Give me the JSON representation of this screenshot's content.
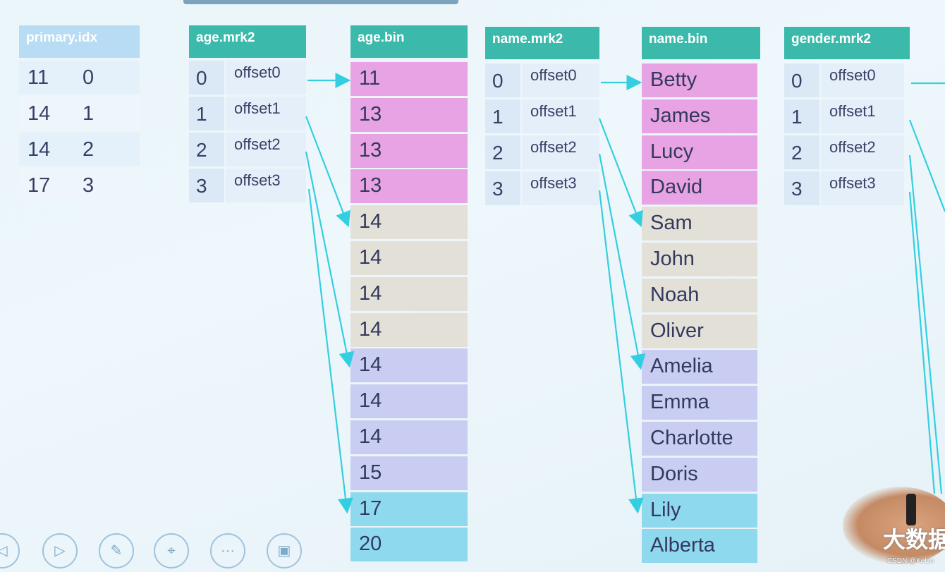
{
  "colors": {
    "teal_header": "#3bb9ab",
    "blue_header": "#b7dcf4",
    "pink": "#e7a3e3",
    "beige": "#e3e0d8",
    "lavender": "#c9cdf2",
    "cyan": "#8fd9ee",
    "arrow": "#33cfe0"
  },
  "primary_idx": {
    "title": "primary.idx",
    "rows": [
      [
        "11",
        "0"
      ],
      [
        "14",
        "1"
      ],
      [
        "14",
        "2"
      ],
      [
        "17",
        "3"
      ]
    ]
  },
  "age_mrk2": {
    "title": "age.mrk2",
    "rows": [
      [
        "0",
        "offset0"
      ],
      [
        "1",
        "offset1"
      ],
      [
        "2",
        "offset2"
      ],
      [
        "3",
        "offset3"
      ]
    ]
  },
  "age_bin": {
    "title": "age.bin",
    "values": [
      "11",
      "13",
      "13",
      "13",
      "14",
      "14",
      "14",
      "14",
      "14",
      "14",
      "14",
      "15",
      "17",
      "20"
    ],
    "groups": [
      "pink",
      "pink",
      "pink",
      "pink",
      "beige",
      "beige",
      "beige",
      "beige",
      "lavender",
      "lavender",
      "lavender",
      "lavender",
      "cyan",
      "cyan"
    ]
  },
  "name_mrk2": {
    "title": "name.mrk2",
    "rows": [
      [
        "0",
        "offset0"
      ],
      [
        "1",
        "offset1"
      ],
      [
        "2",
        "offset2"
      ],
      [
        "3",
        "offset3"
      ]
    ]
  },
  "name_bin": {
    "title": "name.bin",
    "values": [
      "Betty",
      "James",
      "Lucy",
      "David",
      "Sam",
      "John",
      "Noah",
      "Oliver",
      "Amelia",
      "Emma",
      "Charlotte",
      "Doris",
      "Lily",
      "Alberta"
    ],
    "groups": [
      "pink",
      "pink",
      "pink",
      "pink",
      "beige",
      "beige",
      "beige",
      "beige",
      "lavender",
      "lavender",
      "lavender",
      "lavender",
      "cyan",
      "cyan"
    ]
  },
  "gender_mrk2": {
    "title": "gender.mrk2",
    "rows": [
      [
        "0",
        "offset0"
      ],
      [
        "1",
        "offset1"
      ],
      [
        "2",
        "offset2"
      ],
      [
        "3",
        "offset3"
      ]
    ]
  },
  "toolbar": {
    "icons": [
      "prev-icon",
      "play-icon",
      "pen-icon",
      "pointer-icon",
      "more-icon",
      "screen-icon"
    ]
  },
  "watermark": "大数据",
  "credit": "CSDN @Kelzn"
}
